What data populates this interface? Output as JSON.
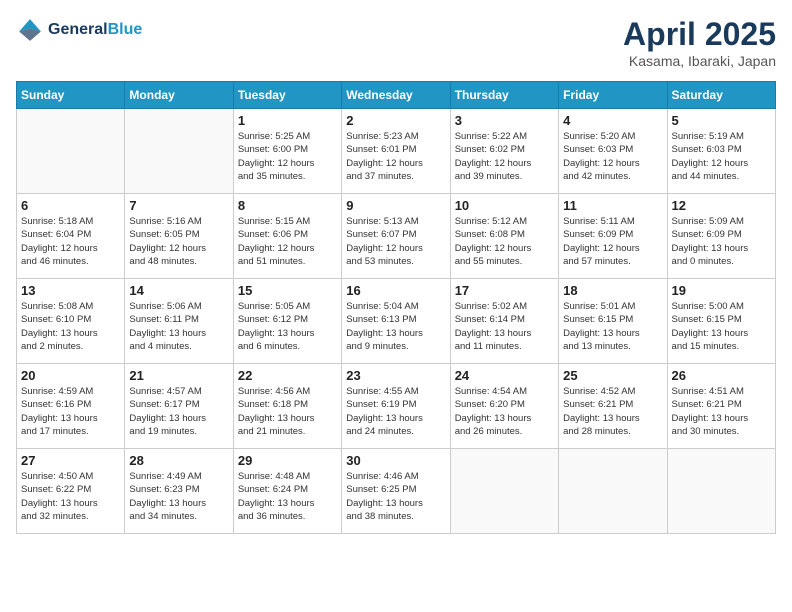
{
  "header": {
    "logo_line1": "General",
    "logo_line2": "Blue",
    "month_year": "April 2025",
    "location": "Kasama, Ibaraki, Japan"
  },
  "weekdays": [
    "Sunday",
    "Monday",
    "Tuesday",
    "Wednesday",
    "Thursday",
    "Friday",
    "Saturday"
  ],
  "weeks": [
    [
      {
        "day": "",
        "info": ""
      },
      {
        "day": "",
        "info": ""
      },
      {
        "day": "1",
        "info": "Sunrise: 5:25 AM\nSunset: 6:00 PM\nDaylight: 12 hours\nand 35 minutes."
      },
      {
        "day": "2",
        "info": "Sunrise: 5:23 AM\nSunset: 6:01 PM\nDaylight: 12 hours\nand 37 minutes."
      },
      {
        "day": "3",
        "info": "Sunrise: 5:22 AM\nSunset: 6:02 PM\nDaylight: 12 hours\nand 39 minutes."
      },
      {
        "day": "4",
        "info": "Sunrise: 5:20 AM\nSunset: 6:03 PM\nDaylight: 12 hours\nand 42 minutes."
      },
      {
        "day": "5",
        "info": "Sunrise: 5:19 AM\nSunset: 6:03 PM\nDaylight: 12 hours\nand 44 minutes."
      }
    ],
    [
      {
        "day": "6",
        "info": "Sunrise: 5:18 AM\nSunset: 6:04 PM\nDaylight: 12 hours\nand 46 minutes."
      },
      {
        "day": "7",
        "info": "Sunrise: 5:16 AM\nSunset: 6:05 PM\nDaylight: 12 hours\nand 48 minutes."
      },
      {
        "day": "8",
        "info": "Sunrise: 5:15 AM\nSunset: 6:06 PM\nDaylight: 12 hours\nand 51 minutes."
      },
      {
        "day": "9",
        "info": "Sunrise: 5:13 AM\nSunset: 6:07 PM\nDaylight: 12 hours\nand 53 minutes."
      },
      {
        "day": "10",
        "info": "Sunrise: 5:12 AM\nSunset: 6:08 PM\nDaylight: 12 hours\nand 55 minutes."
      },
      {
        "day": "11",
        "info": "Sunrise: 5:11 AM\nSunset: 6:09 PM\nDaylight: 12 hours\nand 57 minutes."
      },
      {
        "day": "12",
        "info": "Sunrise: 5:09 AM\nSunset: 6:09 PM\nDaylight: 13 hours\nand 0 minutes."
      }
    ],
    [
      {
        "day": "13",
        "info": "Sunrise: 5:08 AM\nSunset: 6:10 PM\nDaylight: 13 hours\nand 2 minutes."
      },
      {
        "day": "14",
        "info": "Sunrise: 5:06 AM\nSunset: 6:11 PM\nDaylight: 13 hours\nand 4 minutes."
      },
      {
        "day": "15",
        "info": "Sunrise: 5:05 AM\nSunset: 6:12 PM\nDaylight: 13 hours\nand 6 minutes."
      },
      {
        "day": "16",
        "info": "Sunrise: 5:04 AM\nSunset: 6:13 PM\nDaylight: 13 hours\nand 9 minutes."
      },
      {
        "day": "17",
        "info": "Sunrise: 5:02 AM\nSunset: 6:14 PM\nDaylight: 13 hours\nand 11 minutes."
      },
      {
        "day": "18",
        "info": "Sunrise: 5:01 AM\nSunset: 6:15 PM\nDaylight: 13 hours\nand 13 minutes."
      },
      {
        "day": "19",
        "info": "Sunrise: 5:00 AM\nSunset: 6:15 PM\nDaylight: 13 hours\nand 15 minutes."
      }
    ],
    [
      {
        "day": "20",
        "info": "Sunrise: 4:59 AM\nSunset: 6:16 PM\nDaylight: 13 hours\nand 17 minutes."
      },
      {
        "day": "21",
        "info": "Sunrise: 4:57 AM\nSunset: 6:17 PM\nDaylight: 13 hours\nand 19 minutes."
      },
      {
        "day": "22",
        "info": "Sunrise: 4:56 AM\nSunset: 6:18 PM\nDaylight: 13 hours\nand 21 minutes."
      },
      {
        "day": "23",
        "info": "Sunrise: 4:55 AM\nSunset: 6:19 PM\nDaylight: 13 hours\nand 24 minutes."
      },
      {
        "day": "24",
        "info": "Sunrise: 4:54 AM\nSunset: 6:20 PM\nDaylight: 13 hours\nand 26 minutes."
      },
      {
        "day": "25",
        "info": "Sunrise: 4:52 AM\nSunset: 6:21 PM\nDaylight: 13 hours\nand 28 minutes."
      },
      {
        "day": "26",
        "info": "Sunrise: 4:51 AM\nSunset: 6:21 PM\nDaylight: 13 hours\nand 30 minutes."
      }
    ],
    [
      {
        "day": "27",
        "info": "Sunrise: 4:50 AM\nSunset: 6:22 PM\nDaylight: 13 hours\nand 32 minutes."
      },
      {
        "day": "28",
        "info": "Sunrise: 4:49 AM\nSunset: 6:23 PM\nDaylight: 13 hours\nand 34 minutes."
      },
      {
        "day": "29",
        "info": "Sunrise: 4:48 AM\nSunset: 6:24 PM\nDaylight: 13 hours\nand 36 minutes."
      },
      {
        "day": "30",
        "info": "Sunrise: 4:46 AM\nSunset: 6:25 PM\nDaylight: 13 hours\nand 38 minutes."
      },
      {
        "day": "",
        "info": ""
      },
      {
        "day": "",
        "info": ""
      },
      {
        "day": "",
        "info": ""
      }
    ]
  ]
}
